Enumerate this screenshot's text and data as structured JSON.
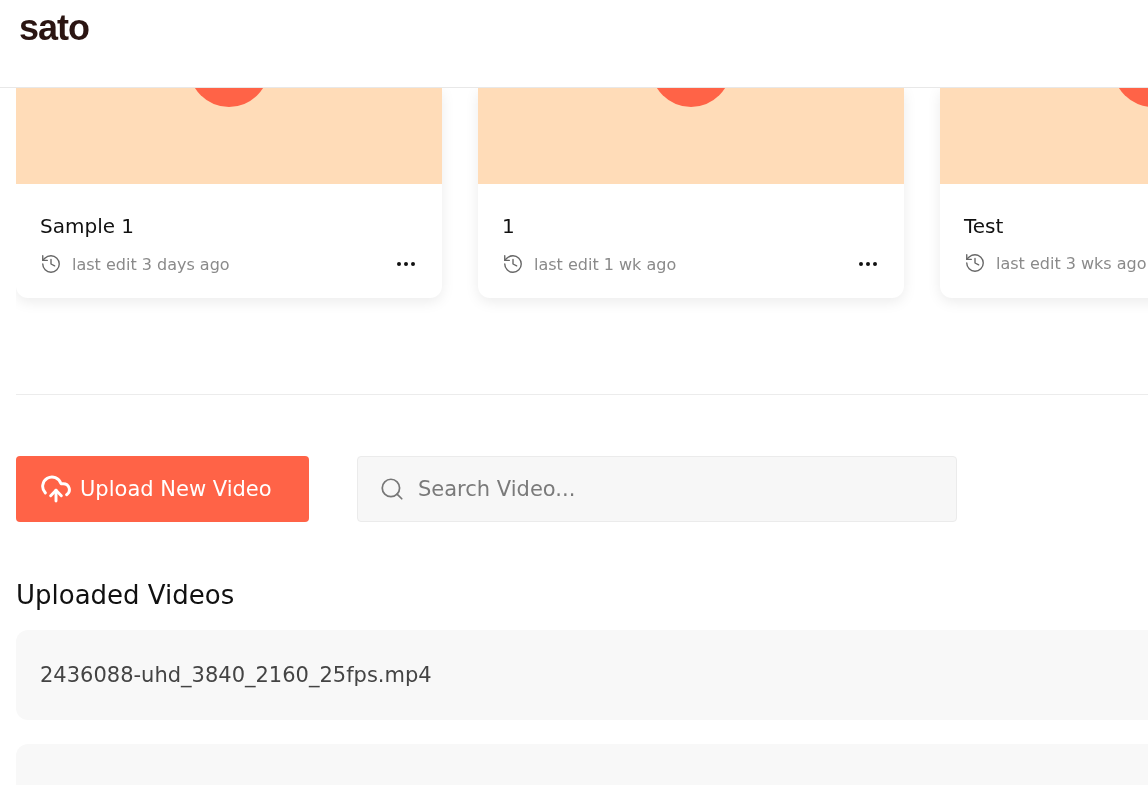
{
  "header": {
    "logo": "sato"
  },
  "projects": [
    {
      "title": "Sample 1",
      "meta": "last edit 3 days ago",
      "menu": true
    },
    {
      "title": "1",
      "meta": "last edit 1 wk ago",
      "menu": true
    },
    {
      "title": "Test",
      "meta": "last edit 3 wks ago",
      "menu": false
    }
  ],
  "toolbar": {
    "upload_button": "Upload New Video",
    "search": {
      "placeholder": "Search Video..."
    }
  },
  "uploaded": {
    "heading": "Uploaded Videos",
    "rows": [
      {
        "name": "2436088-uhd_3840_2160_25fps.mp4"
      }
    ]
  }
}
